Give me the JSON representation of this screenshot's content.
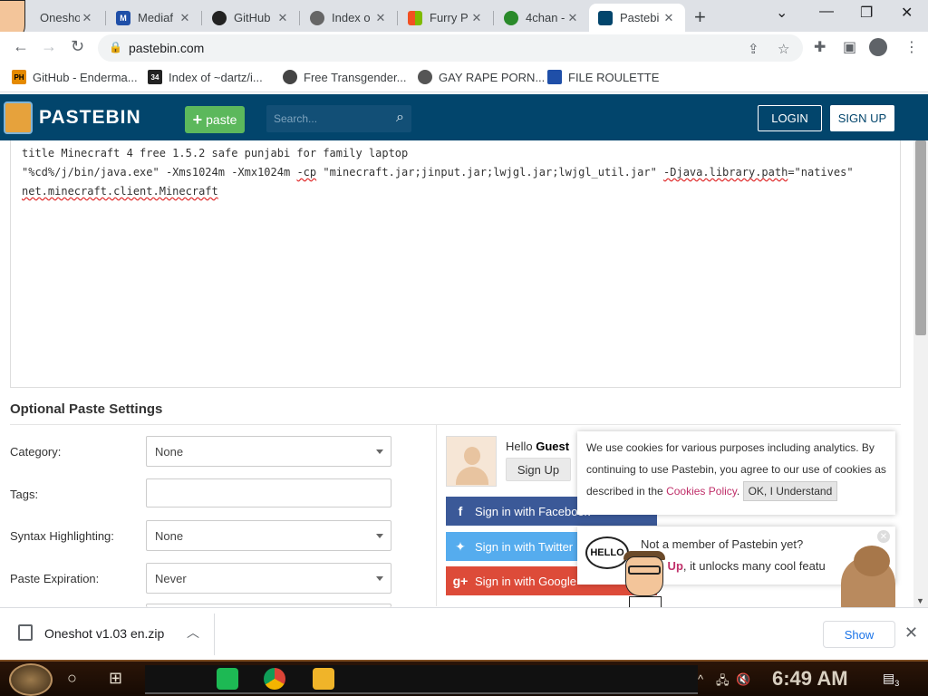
{
  "browser": {
    "tabs": [
      {
        "title": "Onesho",
        "fav_color": "#c44",
        "active": false
      },
      {
        "title": "Mediaf",
        "fav_color": "#1f4fa8",
        "active": false
      },
      {
        "title": "GitHub",
        "fav_color": "#222",
        "active": false
      },
      {
        "title": "Index o",
        "fav_color": "#555",
        "active": false
      },
      {
        "title": "Furry P",
        "fav_color": "#f25022",
        "active": false
      },
      {
        "title": "4chan -",
        "fav_color": "#2a8a2a",
        "active": false
      },
      {
        "title": "Pastebi",
        "fav_color": "#02456c",
        "active": true
      }
    ],
    "url": "pastebin.com"
  },
  "bookmarks": [
    {
      "label": "GitHub - Enderma...",
      "icon": "PH",
      "color": "#e58a00"
    },
    {
      "label": "Index of ~dartz/i...",
      "icon": "34",
      "color": "#222"
    },
    {
      "label": "Free Transgender...",
      "icon": "",
      "color": "#444"
    },
    {
      "label": "GAY RAPE PORN...",
      "icon": "",
      "color": "#555"
    },
    {
      "label": "FILE ROULETTE",
      "icon": "",
      "color": "#1f4fa8"
    }
  ],
  "pastebin": {
    "logo": "PASTEBIN",
    "paste_btn": "paste",
    "search_placeholder": "Search...",
    "login": "LOGIN",
    "signup": "SIGN UP"
  },
  "code": {
    "line1": "title Minecraft 4 free 1.5.2 safe punjabi for family laptop",
    "line2_a": "\"%cd%/j/bin/java.exe\" -Xms1024m -Xmx1024m ",
    "line2_b": "-cp",
    "line2_c": " \"minecraft.jar;jinput.jar;lwjgl.jar;lwjgl_util.jar\" ",
    "line2_d": "-Djava.library.path",
    "line2_e": "=\"natives\"",
    "line3": "net.minecraft.client.Minecraft"
  },
  "settings": {
    "title": "Optional Paste Settings",
    "category_label": "Category:",
    "category_value": "None",
    "tags_label": "Tags:",
    "syntax_label": "Syntax Highlighting:",
    "syntax_value": "None",
    "expiration_label": "Paste Expiration:",
    "expiration_value": "Never"
  },
  "guest": {
    "hello": "Hello",
    "name": "Guest",
    "signup_btn": "Sign Up",
    "facebook": "Sign in with Facebook",
    "twitter": "Sign in with Twitter",
    "google": "Sign in with Google"
  },
  "cookie": {
    "text1": "We use cookies for various purposes including analytics. By continuing to use Pastebin, you agree to our use of cookies as described in the",
    "link": "Cookies Policy",
    "ok": "OK, I Understand"
  },
  "member": {
    "line1": "Not a member of Pastebin yet?",
    "signup": "n Up",
    "line2": ", it unlocks many cool featu"
  },
  "overlay": {
    "bubble": "HELLO"
  },
  "downloads": {
    "file": "Oneshot v1.03 en.zip",
    "show_all": "Show"
  },
  "taskbar": {
    "time": "6:49 AM",
    "notify_count": "3"
  }
}
